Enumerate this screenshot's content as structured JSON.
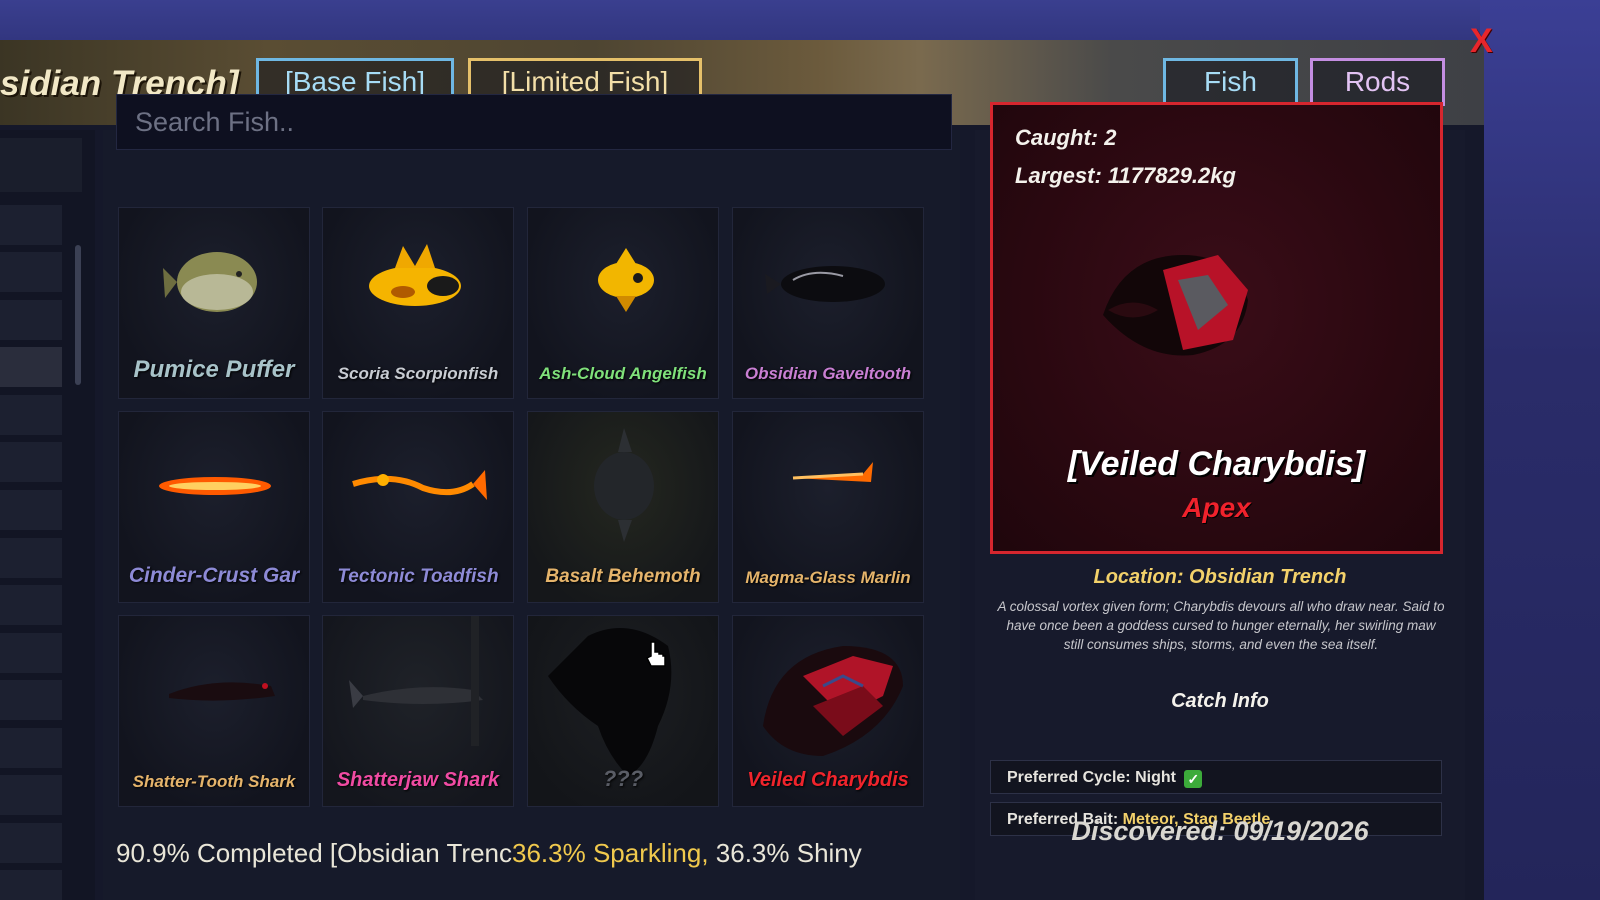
{
  "header": {
    "zone_title": "sidian Trench]",
    "tabs": [
      "[Base Fish]",
      "[Limited Fish]"
    ],
    "right_tabs": [
      "Fish",
      "Rods"
    ],
    "close_label": "X"
  },
  "search": {
    "placeholder": "Search Fish.."
  },
  "fish": [
    {
      "name": "Pumice Puffer",
      "color": "#a8c3c9"
    },
    {
      "name": "Scoria Scorpionfish",
      "color": "#c8ccd2"
    },
    {
      "name": "Ash-Cloud Angelfish",
      "color": "#7fe07a"
    },
    {
      "name": "Obsidian Gaveltooth",
      "color": "#c97fd3"
    },
    {
      "name": "Cinder-Crust Gar",
      "color": "#8d8ad6"
    },
    {
      "name": "Tectonic Toadfish",
      "color": "#8d8ad6"
    },
    {
      "name": "Basalt Behemoth",
      "color": "#e5b46b"
    },
    {
      "name": "Magma-Glass Marlin",
      "color": "#e5b46b"
    },
    {
      "name": "Shatter-Tooth Shark",
      "color": "#e5b46b"
    },
    {
      "name": "Shatterjaw Shark",
      "color": "#f04ba3"
    },
    {
      "name": "???",
      "color": "#5a5d66"
    },
    {
      "name": "Veiled Charybdis",
      "color": "#f0242c"
    }
  ],
  "completion": {
    "main": "90.9% Completed [Obsidian Trenc",
    "sparkling": "36.3% Sparkling,",
    "shiny": " 36.3% Shiny"
  },
  "detail": {
    "caught": "Caught: 2",
    "largest": "Largest: 1177829.2kg",
    "title": "[Veiled Charybdis]",
    "rarity": "Apex",
    "location": "Location: Obsidian Trench",
    "description": "A colossal vortex given form; Charybdis devours all who draw near. Said to have once been a goddess cursed to hunger eternally, her swirling maw still consumes ships, storms, and even the sea itself.",
    "catch_info_title": "Catch Info",
    "cycle_label": "Preferred Cycle:",
    "cycle_value": "Night",
    "bait_label": "Preferred Bait:",
    "bait_value": "Meteor, Stag Beetle",
    "discovered": "Discovered: 09/19/2026"
  },
  "icons": {
    "close": "close-icon",
    "check": "checkmark-icon",
    "cursor": "hand-pointer-icon"
  },
  "colors": {
    "accent_red": "#d6262e",
    "gold": "#f3d16a",
    "blue_tab": "#6fb8e3",
    "purple_tab": "#c48ee2",
    "gold_tab": "#e5c06a"
  }
}
